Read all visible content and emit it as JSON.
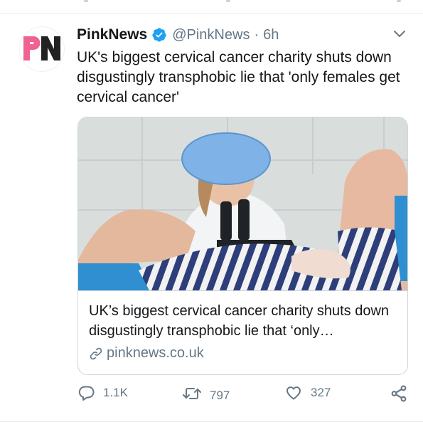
{
  "tweet": {
    "author_name": "PinkNews",
    "handle": "@PinkNews",
    "separator": "·",
    "time": "6h",
    "text": "UK's biggest cervical cancer charity shuts down disgustingly transphobic lie that 'only females get cervical cancer'",
    "avatar_text": "PN"
  },
  "card": {
    "title": "UK’s biggest cervical cancer charity shuts down disgustingly transphobic lie that ‘only…",
    "domain": "pinknews.co.uk"
  },
  "actions": {
    "reply_count": "1.1K",
    "retweet_count": "797",
    "like_count": "327"
  },
  "colors": {
    "verified": "#1da1f2",
    "secondary_text": "#657786",
    "border": "#ccd6dd",
    "logo_pink": "#f06292",
    "logo_dark": "#222222"
  },
  "icons": {
    "verified": "verified-badge-icon",
    "chevron": "chevron-down-icon",
    "link": "link-icon",
    "reply": "reply-icon",
    "retweet": "retweet-icon",
    "like": "heart-icon",
    "share": "share-icon"
  }
}
